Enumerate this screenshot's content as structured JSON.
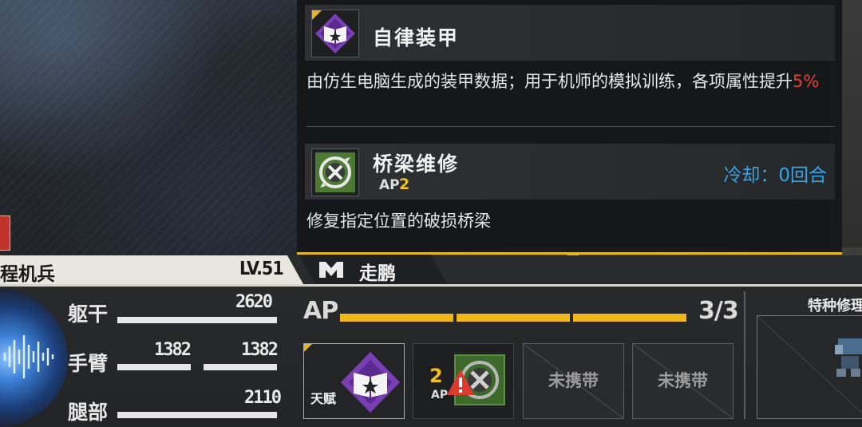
{
  "tooltip": {
    "talent": {
      "name": "自律装甲",
      "icon": "book-star-icon",
      "description_main": "由仿生电脑生成的装甲数据；用于机师的模拟训练，各项属性提升",
      "description_highlight": "5%"
    },
    "skill": {
      "name": "桥梁维修",
      "icon": "wrench-hammer-icon",
      "ap_label": "AP",
      "ap_cost": "2",
      "cooldown": "冷却：0回合",
      "description": "修复指定位置的破损桥梁"
    }
  },
  "unit": {
    "name": "程机兵",
    "level": "LV.51",
    "pilot_name": "走鹏",
    "pilot_icon": "pilot-logo-icon",
    "stats": [
      {
        "label": "躯干",
        "value": "2620"
      },
      {
        "label": "手臂",
        "value_left": "1382",
        "value_right": "1382"
      },
      {
        "label": "腿部",
        "value": "2110"
      }
    ]
  },
  "ap": {
    "label": "AP",
    "current": 3,
    "max": 3,
    "count_text": "3/3"
  },
  "slots": [
    {
      "type": "talent",
      "label": "天赋",
      "icon": "book-star-icon"
    },
    {
      "type": "skill",
      "ap": "2",
      "ap_label": "AP",
      "icon": "wrench-hammer-icon",
      "warning_icon": "warning-icon"
    },
    {
      "type": "empty",
      "label": "未携带"
    },
    {
      "type": "empty",
      "label": "未携带"
    }
  ],
  "special": {
    "title": "特种修理"
  },
  "colors": {
    "accent_yellow": "#e8b421",
    "highlight_red": "#e0413b",
    "cooldown_blue": "#35a4e8",
    "skill_green": "#4c7a35",
    "talent_purple": "#7a3fb5"
  }
}
